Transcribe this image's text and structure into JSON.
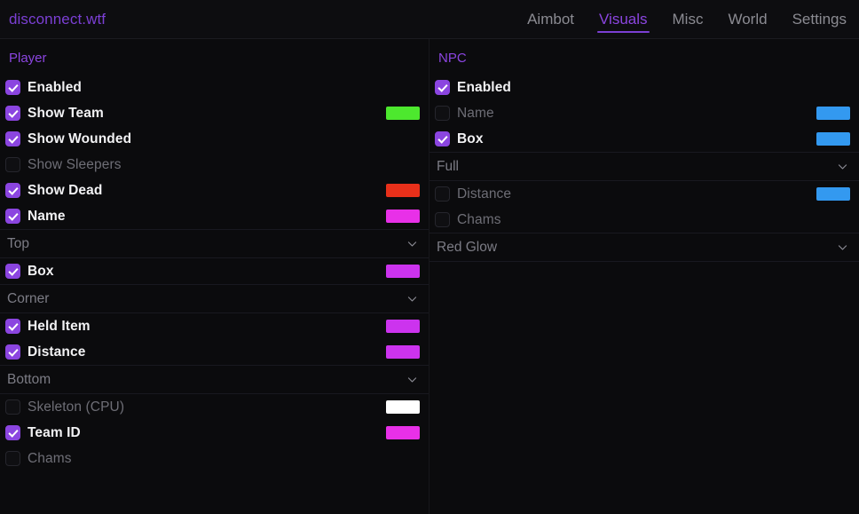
{
  "window": {
    "brand": "disconnect.wtf"
  },
  "nav": {
    "tabs": [
      {
        "label": "Aimbot",
        "active": false
      },
      {
        "label": "Visuals",
        "active": true
      },
      {
        "label": "Misc",
        "active": false
      },
      {
        "label": "World",
        "active": false
      },
      {
        "label": "Settings",
        "active": false
      }
    ],
    "active_accent": "#7b3fd4"
  },
  "colors": {
    "accent_purple": "#8b45e0",
    "checkbox_on": "#8b45e0",
    "green": "#4de82e",
    "red": "#e8301a",
    "magenta": "#e830e8",
    "violet": "#cc33ee",
    "white": "#ffffff",
    "blue": "#3399f0"
  },
  "player_panel": {
    "title": "Player",
    "items": [
      {
        "kind": "toggle",
        "label": "Enabled",
        "checked": true,
        "swatch": null
      },
      {
        "kind": "toggle",
        "label": "Show Team",
        "checked": true,
        "swatch": "#4de82e"
      },
      {
        "kind": "toggle",
        "label": "Show Wounded",
        "checked": true,
        "swatch": null
      },
      {
        "kind": "toggle",
        "label": "Show Sleepers",
        "checked": false,
        "swatch": null
      },
      {
        "kind": "toggle",
        "label": "Show Dead",
        "checked": true,
        "swatch": "#e8301a"
      },
      {
        "kind": "toggle",
        "label": "Name",
        "checked": true,
        "swatch": "#e830e8"
      },
      {
        "kind": "dropdown",
        "label": "Top",
        "icon": "chevron-down-icon"
      },
      {
        "kind": "toggle",
        "label": "Box",
        "checked": true,
        "swatch": "#cc33ee"
      },
      {
        "kind": "dropdown",
        "label": "Corner",
        "icon": "chevron-down-icon"
      },
      {
        "kind": "toggle",
        "label": "Held Item",
        "checked": true,
        "swatch": "#cc33ee"
      },
      {
        "kind": "toggle",
        "label": "Distance",
        "checked": true,
        "swatch": "#cc33ee"
      },
      {
        "kind": "dropdown",
        "label": "Bottom",
        "icon": "chevron-down-icon"
      },
      {
        "kind": "toggle",
        "label": "Skeleton (CPU)",
        "checked": false,
        "swatch": "#ffffff"
      },
      {
        "kind": "toggle",
        "label": "Team ID",
        "checked": true,
        "swatch": "#e830e8"
      },
      {
        "kind": "toggle",
        "label": "Chams",
        "checked": false,
        "swatch": null
      }
    ]
  },
  "npc_panel": {
    "title": "NPC",
    "items": [
      {
        "kind": "toggle",
        "label": "Enabled",
        "checked": true,
        "swatch": null
      },
      {
        "kind": "toggle",
        "label": "Name",
        "checked": false,
        "swatch": "#3399f0"
      },
      {
        "kind": "toggle",
        "label": "Box",
        "checked": true,
        "swatch": "#3399f0"
      },
      {
        "kind": "dropdown",
        "label": "Full",
        "icon": "chevron-down-icon"
      },
      {
        "kind": "toggle",
        "label": "Distance",
        "checked": false,
        "swatch": "#3399f0"
      },
      {
        "kind": "toggle",
        "label": "Chams",
        "checked": false,
        "swatch": null
      },
      {
        "kind": "dropdown",
        "label": "Red Glow",
        "icon": "chevron-down-icon"
      }
    ]
  }
}
